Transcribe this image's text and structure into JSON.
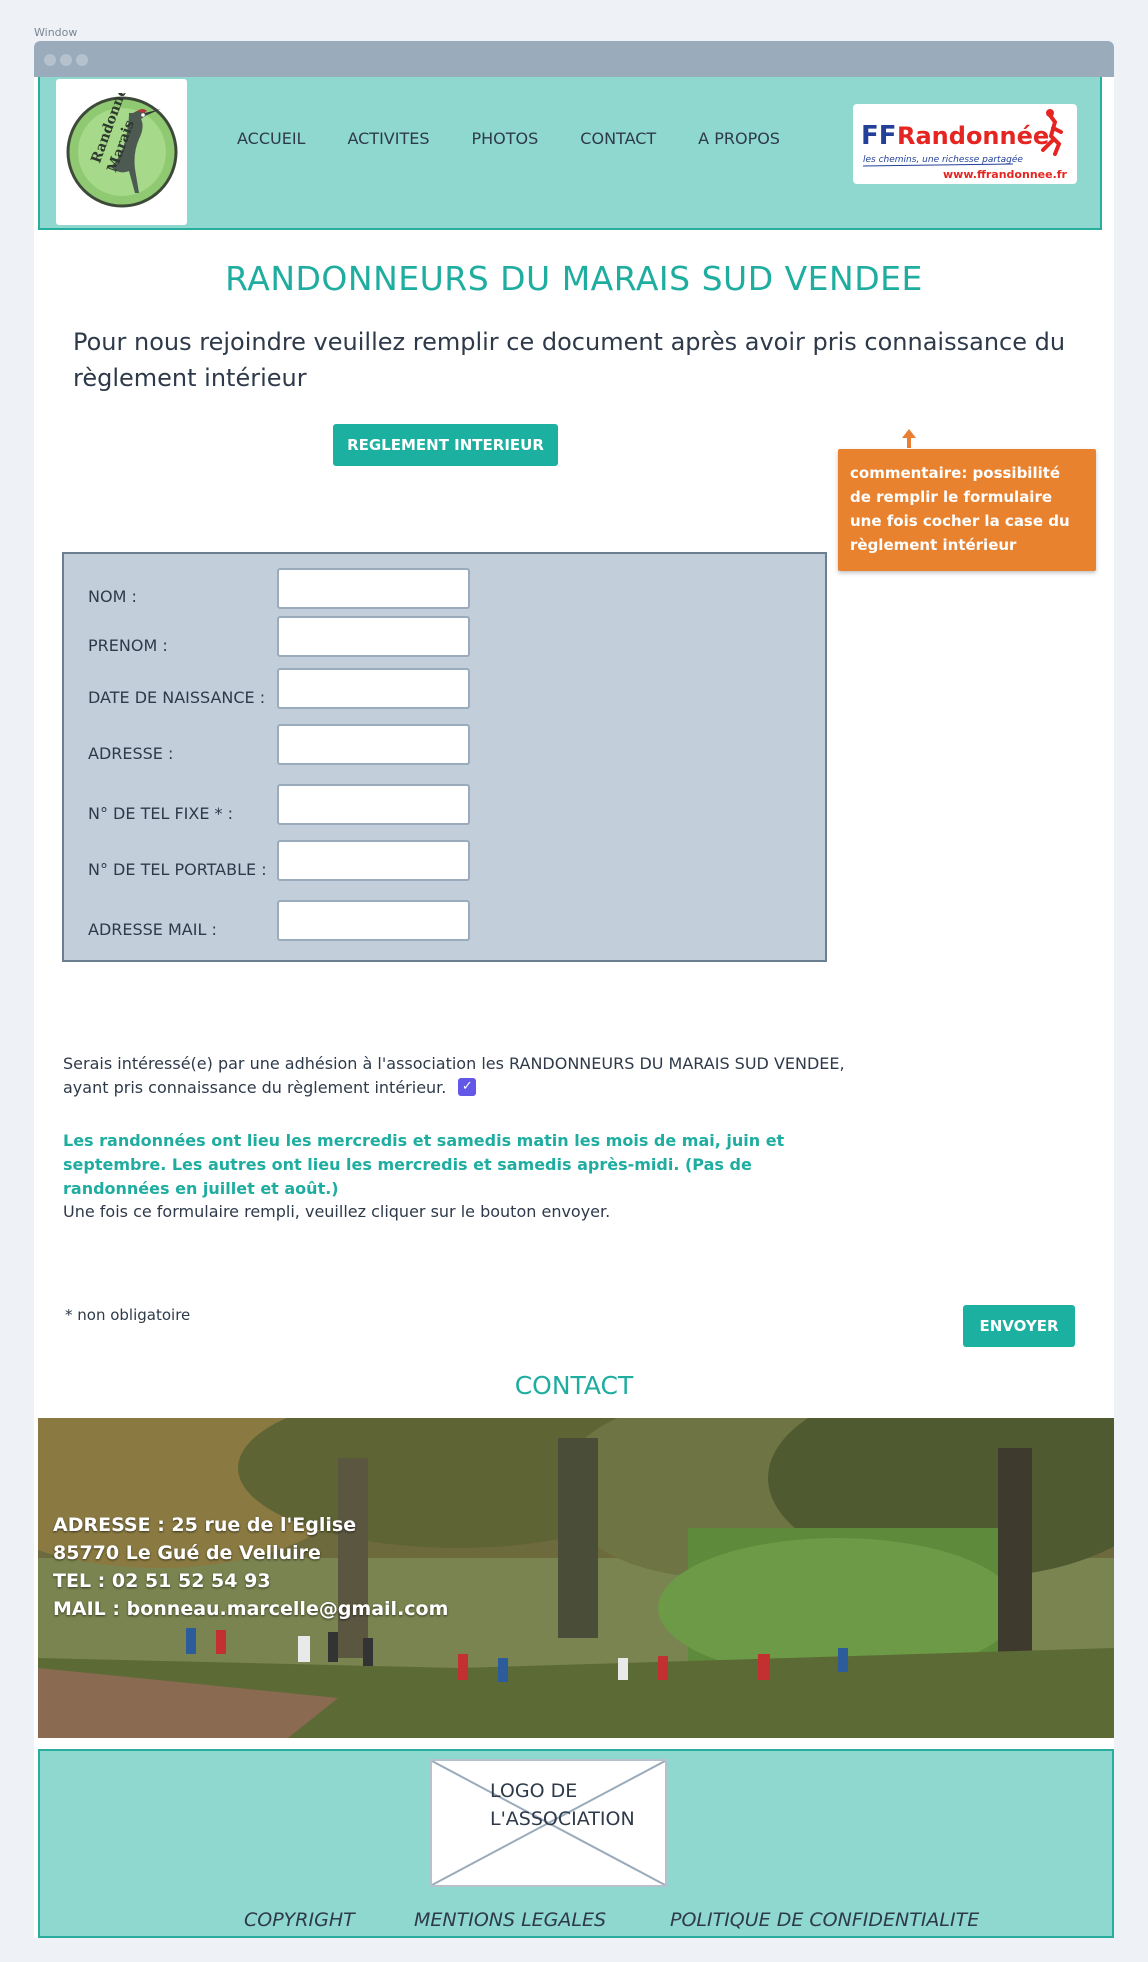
{
  "window": {
    "label": "Window"
  },
  "nav": {
    "items": [
      "ACCUEIL",
      "ACTIVITES",
      "PHOTOS",
      "CONTACT",
      "A PROPOS"
    ]
  },
  "logos": {
    "left_text": "Randonneurs du Marais",
    "right_main": "FFRandonnée",
    "right_tagline": "les chemins, une richesse partagée",
    "right_url": "www.ffrandonnee.fr"
  },
  "page": {
    "title": "RANDONNEURS DU MARAIS SUD VENDEE",
    "intro": "Pour nous rejoindre veuillez remplir ce document après avoir pris connaissance du règlement intérieur",
    "reglement_button": "REGLEMENT INTERIEUR",
    "comment": "commentaire: possibilité de remplir le formulaire une fois cocher la  case du règlement intérieur"
  },
  "form": {
    "fields": [
      {
        "label": "NOM :",
        "value": ""
      },
      {
        "label": "PRENOM :",
        "value": ""
      },
      {
        "label": "DATE DE NAISSANCE :",
        "value": ""
      },
      {
        "label": "ADRESSE :",
        "value": ""
      },
      {
        "label": "N° DE TEL FIXE * :",
        "value": ""
      },
      {
        "label": "N° DE TEL PORTABLE :",
        "value": ""
      },
      {
        "label": "ADRESSE MAIL :",
        "value": ""
      }
    ],
    "consent": "Serais intéressé(e) par une adhésion à l'association les RANDONNEURS DU MARAIS SUD VENDEE, ayant pris connaissance du règlement intérieur.",
    "consent_checked": true,
    "info": "Les randonnées ont lieu les mercredis et samedis matin les mois de mai, juin et septembre. Les autres ont lieu les mercredis et samedis après-midi. (Pas de randonnées en juillet et août.)",
    "instruction": "Une fois ce formulaire rempli, veuillez cliquer sur le bouton envoyer.",
    "note": "* non obligatoire",
    "submit_label": "ENVOYER"
  },
  "contact": {
    "title": "CONTACT",
    "address_line1": "ADRESSE : 25 rue de l'Eglise",
    "address_line2": "85770 Le Gué de Velluire",
    "tel": "TEL : 02 51 52 54 93",
    "mail": "MAIL : bonneau.marcelle@gmail.com"
  },
  "footer": {
    "logo_placeholder_line1": "LOGO DE",
    "logo_placeholder_line2": "L'ASSOCIATION",
    "links": [
      "COPYRIGHT",
      "MENTIONS LEGALES",
      "POLITIQUE DE CONFIDENTIALITE"
    ]
  },
  "colors": {
    "accent": "#1cb0a0",
    "header_bg": "#8fd8cf",
    "comment_bg": "#e8822f",
    "form_bg": "#c2cfdb",
    "checkbox": "#6257e6"
  }
}
